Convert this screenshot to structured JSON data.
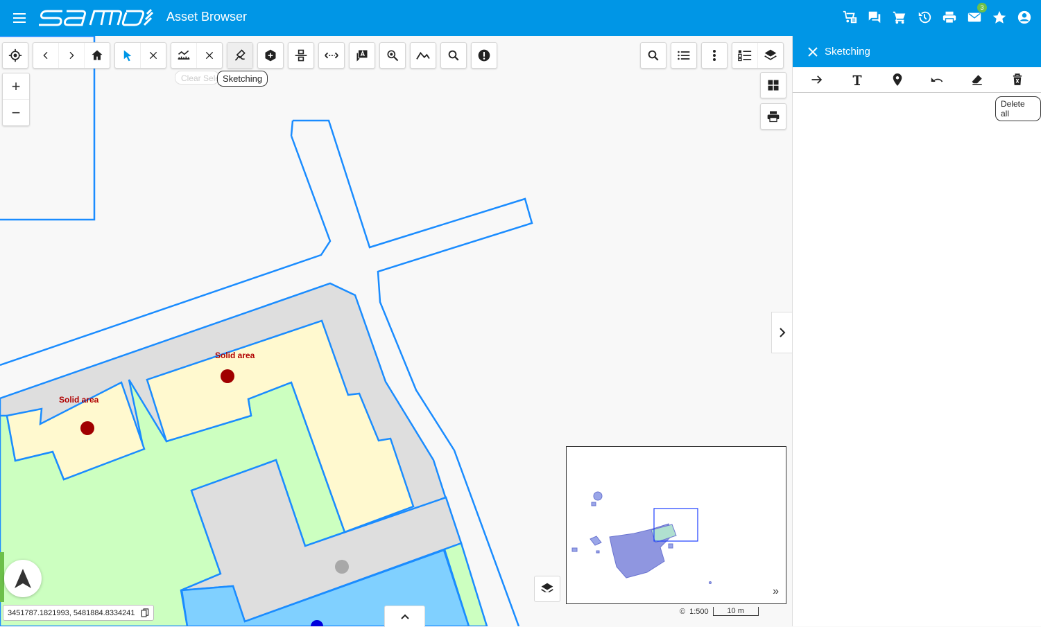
{
  "app": {
    "title": "Asset Browser",
    "brand": "samo",
    "accent_color": "#0096e6",
    "mail_badge": "3"
  },
  "header_icons": [
    "cart-list-icon",
    "chat-icon",
    "cart-icon",
    "history-icon",
    "print-icon",
    "mail-icon",
    "star-icon",
    "account-icon"
  ],
  "toolbar": {
    "tooltip": "Sketching",
    "ghost_label": "Clear Selection"
  },
  "zoom": {
    "in": "+",
    "out": "−"
  },
  "map": {
    "labels": [
      {
        "text": "Solid area"
      },
      {
        "text": "Solid area"
      }
    ]
  },
  "scale": {
    "ratio": "1:500",
    "bar_label": "10 m",
    "copyright": "©"
  },
  "coords": {
    "value": "3451787.1821993, 5481884.8334241"
  },
  "overview": {
    "expand": "»"
  },
  "panel": {
    "title": "Sketching",
    "tooltip": "Delete all"
  }
}
